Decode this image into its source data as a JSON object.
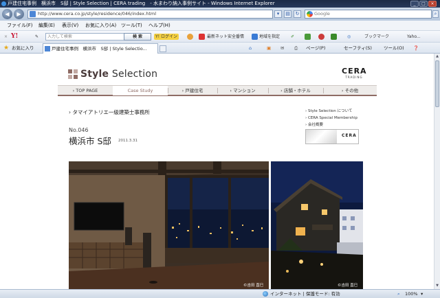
{
  "window": {
    "title": "戸建住宅事例　横浜市　S邸 | Style Selection | CERA trading　- 水まわり納入事例サイト - Windows Internet Explorer"
  },
  "addressbar": {
    "url": "http://www.cera.co.jp/style/residence/046/index.html",
    "search_placeholder": "Google"
  },
  "menu": {
    "items": [
      "ファイル(F)",
      "編集(E)",
      "表示(V)",
      "お気に入り(A)",
      "ツール(T)",
      "ヘルプ(H)"
    ]
  },
  "yahoo_toolbar": {
    "logo": "Y!",
    "search_placeholder": "入力して検索",
    "search_button": "検 索",
    "login": "Y! ログイン",
    "news": "最新ネット安全番情",
    "area": "地域を指定",
    "bookmarks": "ブックマーク",
    "yahoo": "Yaho..."
  },
  "favorites_bar": {
    "favorites_label": "お気に入り",
    "tab_title": "戸建住宅事例　横浜市　S邸 | Style Selectio...",
    "page_menu": "ページ(P)",
    "safety_menu": "セーフティ(S)",
    "tools_menu": "ツール(O)"
  },
  "site": {
    "logo_style": "Style",
    "logo_selection": "Selection",
    "brand_main": "CERA",
    "brand_sub": "TRADING",
    "nav": [
      "TOP PAGE",
      "Case Study",
      "戸建住宅",
      "マンション",
      "店舗・ホテル",
      "その他"
    ],
    "architect": "タマイアトリエ一級建築士事務所",
    "side_links": [
      "Style Selection について",
      "CERA Special Membership",
      "会社概要"
    ],
    "side_banner_label": "CERA",
    "case_number": "No.046",
    "case_title": "横浜市 S邸",
    "case_date": "2011.3.31",
    "photo_credit_1": "©吉田 直巳",
    "photo_credit_2": "©吉田 直巳"
  },
  "statusbar": {
    "zone": "インターネット | 保護モード: 有効",
    "zoom": "100%"
  },
  "colors": {
    "accent": "#8e6b64",
    "titlebar": "#1b2a45"
  }
}
